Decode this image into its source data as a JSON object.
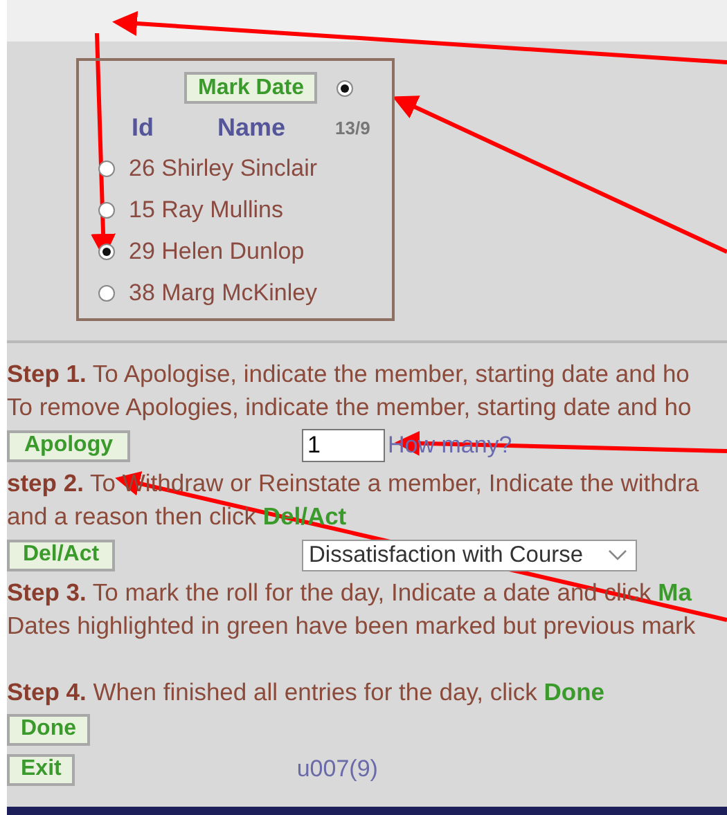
{
  "roster": {
    "mark_date_button": "Mark Date",
    "date_radio": {
      "selected": true
    },
    "date_label": "13/9",
    "columns": [
      "Id",
      "Name"
    ],
    "members": [
      {
        "label": "26 Shirley Sinclair",
        "selected": false
      },
      {
        "label": "15 Ray Mullins",
        "selected": false
      },
      {
        "label": "29 Helen Dunlop",
        "selected": true
      },
      {
        "label": "38 Marg McKinley",
        "selected": false
      }
    ]
  },
  "step1": {
    "label": "Step 1.",
    "lines": [
      "To Apologise, indicate the member, starting date and ho",
      "To remove Apologies, indicate the member, starting date and ho"
    ]
  },
  "apology_button": "Apology",
  "how_many": {
    "value": "1",
    "label": "How many?"
  },
  "step2": {
    "label": "step 2.",
    "lines": [
      "To Withdraw or Reinstate a member, Indicate the withdra",
      "and a reason then click **Del/Act**"
    ]
  },
  "del_act_button": "Del/Act",
  "reason_select": {
    "value": "Dissatisfaction with Course"
  },
  "step3": {
    "label": "Step 3.",
    "lines": [
      "To mark the roll for the day, Indicate a date and click **Ma**",
      "Dates highlighted in green have been marked but previous mark"
    ]
  },
  "step4": {
    "label": "Step 4.",
    "lines": [
      "When finished all entries for the day, click **Done**"
    ]
  },
  "done_button": "Done",
  "exit_button": "Exit",
  "user_code": "u007(9)"
}
